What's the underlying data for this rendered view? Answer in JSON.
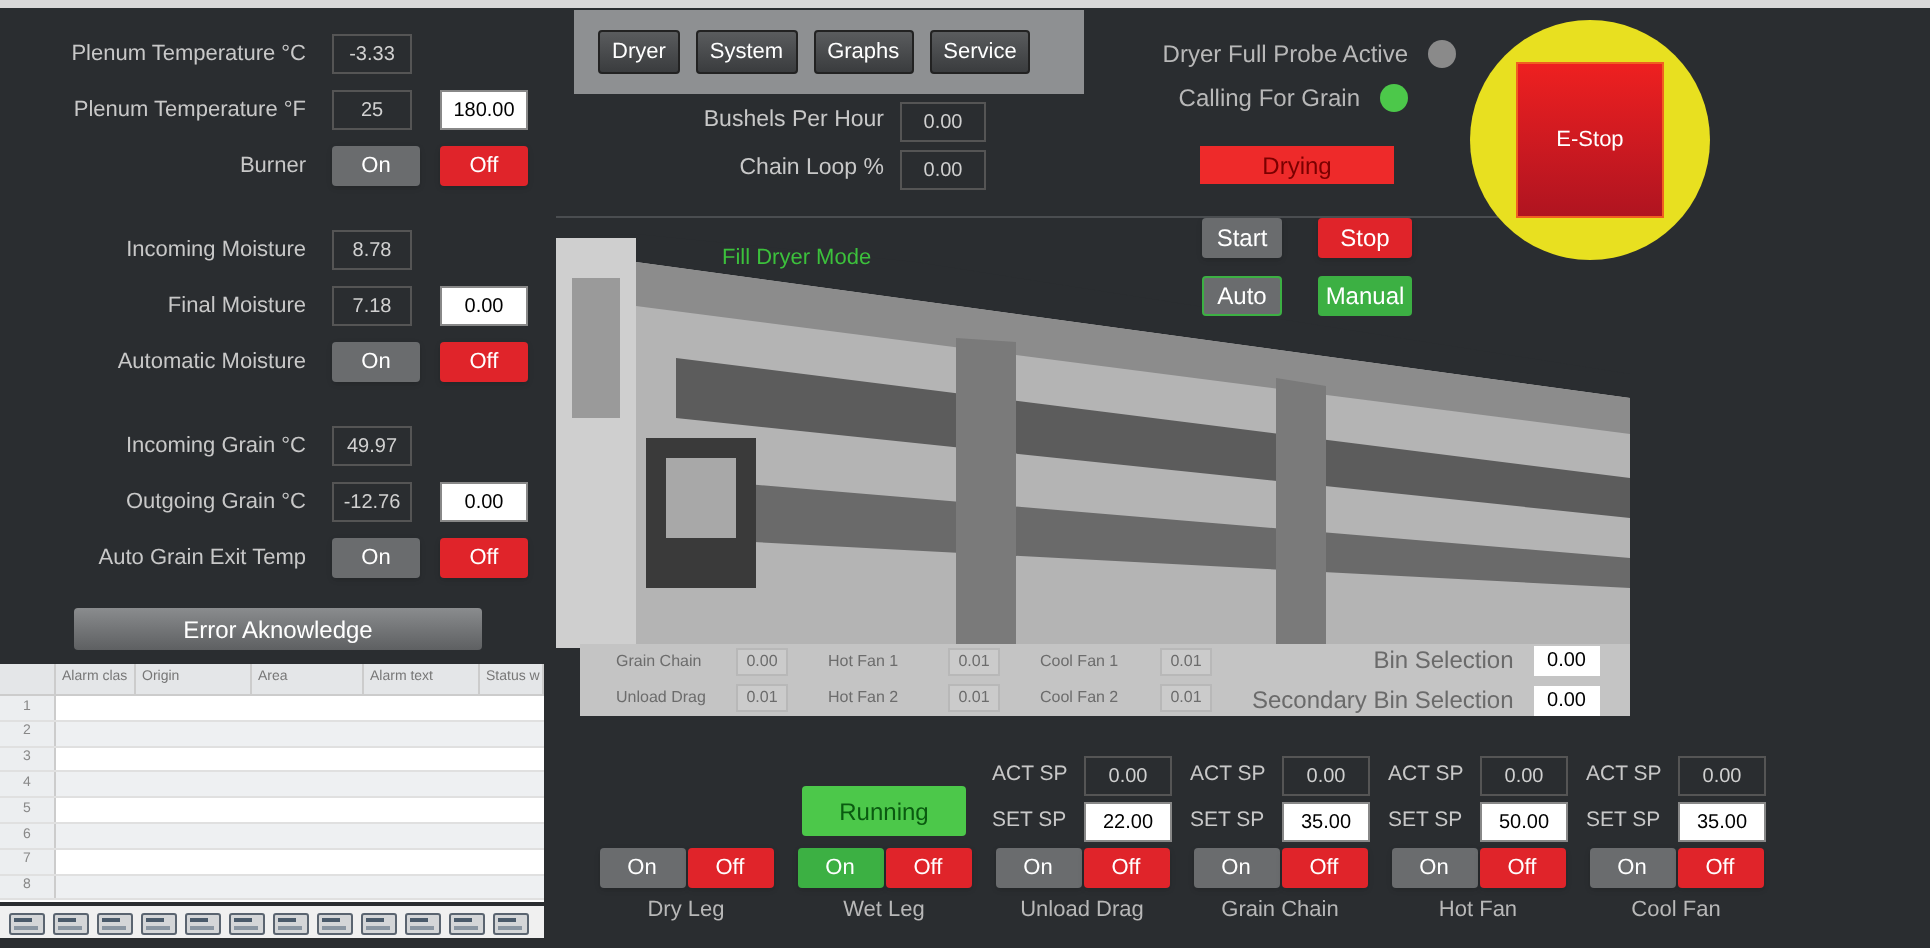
{
  "left_panel": {
    "groups": [
      [
        {
          "kind": "value",
          "label": "Plenum Temperature °C",
          "value": "-3.33"
        },
        {
          "kind": "value",
          "label": "Plenum Temperature °F",
          "value": "25",
          "setpoint": "180.00"
        },
        {
          "kind": "toggle",
          "label": "Burner",
          "on_label": "On",
          "off_label": "Off",
          "on": false
        }
      ],
      [
        {
          "kind": "value",
          "label": "Incoming Moisture",
          "value": "8.78"
        },
        {
          "kind": "value",
          "label": "Final Moisture",
          "value": "7.18",
          "setpoint": "0.00"
        },
        {
          "kind": "toggle",
          "label": "Automatic Moisture",
          "on_label": "On",
          "off_label": "Off",
          "on": false
        }
      ],
      [
        {
          "kind": "value",
          "label": "Incoming Grain °C",
          "value": "49.97"
        },
        {
          "kind": "value",
          "label": "Outgoing Grain °C",
          "value": "-12.76",
          "setpoint": "0.00"
        },
        {
          "kind": "toggle",
          "label": "Auto Grain Exit Temp",
          "on_label": "On",
          "off_label": "Off",
          "on": false
        }
      ]
    ],
    "error_button": "Error Aknowledge",
    "alarm_table": {
      "columns": [
        "Alarm clas",
        "Origin",
        "Area",
        "Alarm text",
        "Status w"
      ],
      "rows": [
        "1",
        "2",
        "3",
        "4",
        "5",
        "6",
        "7",
        "8"
      ]
    }
  },
  "nav_tabs": [
    "Dryer",
    "System",
    "Graphs",
    "Service"
  ],
  "production": [
    {
      "label": "Bushels Per Hour",
      "value": "0.00"
    },
    {
      "label": "Chain Loop %",
      "value": "0.00"
    }
  ],
  "indicators": [
    {
      "label": "Dryer Full Probe Active",
      "on": false
    },
    {
      "label": "Calling For Grain",
      "on": true
    }
  ],
  "status_banner": "Drying",
  "estop": "E-Stop",
  "run_buttons": [
    {
      "label": "Start",
      "kind": "start"
    },
    {
      "label": "Stop",
      "kind": "stop"
    }
  ],
  "mode_buttons": [
    {
      "label": "Auto",
      "selected": false
    },
    {
      "label": "Manual",
      "selected": true
    }
  ],
  "dryer_view": {
    "mode_text": "Fill Dryer Mode",
    "readings": [
      [
        {
          "label": "Grain Chain",
          "value": "0.00"
        },
        {
          "label": "Unload Drag",
          "value": "0.01"
        }
      ],
      [
        {
          "label": "Hot Fan 1",
          "value": "0.01"
        },
        {
          "label": "Hot Fan 2",
          "value": "0.01"
        }
      ],
      [
        {
          "label": "Cool Fan 1",
          "value": "0.01"
        },
        {
          "label": "Cool Fan 2",
          "value": "0.01"
        }
      ]
    ],
    "bin_selection": [
      {
        "label": "Bin Selection",
        "value": "0.00"
      },
      {
        "label": "Secondary Bin Selection",
        "value": "0.00"
      }
    ]
  },
  "motors": [
    {
      "name": "Dry Leg",
      "on_label": "On",
      "off_label": "Off",
      "on": false
    },
    {
      "name": "Wet Leg",
      "status": "Running",
      "on_label": "On",
      "off_label": "Off",
      "on": true
    },
    {
      "name": "Unload Drag",
      "act_label": "ACT SP",
      "act": "0.00",
      "set_label": "SET SP",
      "set": "22.00",
      "on_label": "On",
      "off_label": "Off",
      "on": false
    },
    {
      "name": "Grain Chain",
      "act_label": "ACT SP",
      "act": "0.00",
      "set_label": "SET SP",
      "set": "35.00",
      "on_label": "On",
      "off_label": "Off",
      "on": false
    },
    {
      "name": "Hot Fan",
      "act_label": "ACT SP",
      "act": "0.00",
      "set_label": "SET SP",
      "set": "50.00",
      "on_label": "On",
      "off_label": "Off",
      "on": false
    },
    {
      "name": "Cool Fan",
      "act_label": "ACT SP",
      "act": "0.00",
      "set_label": "SET SP",
      "set": "35.00",
      "on_label": "On",
      "off_label": "Off",
      "on": false
    }
  ]
}
